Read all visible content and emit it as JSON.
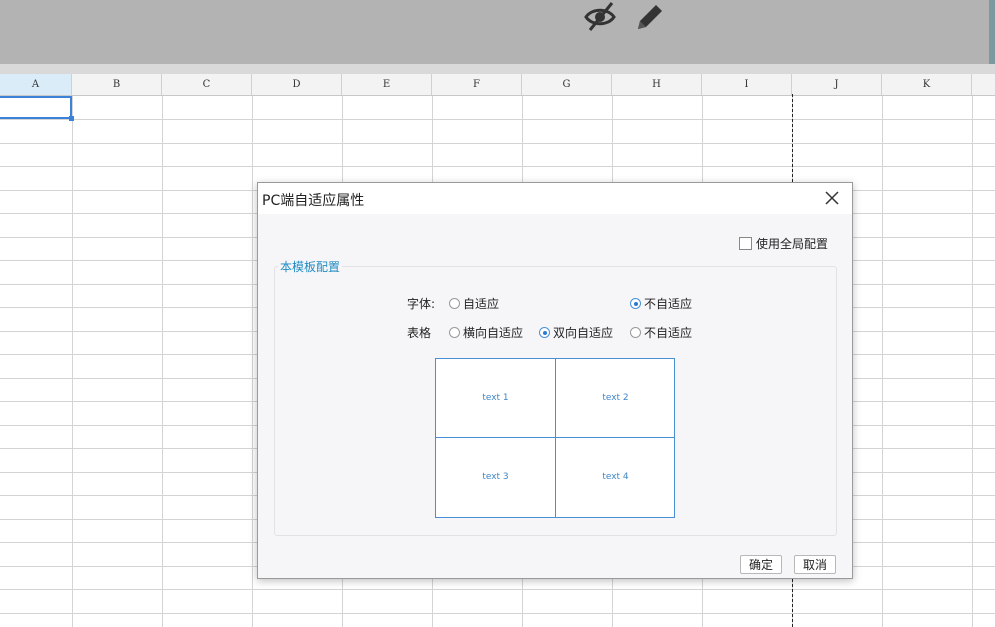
{
  "toolbar": {
    "icons": [
      "eye-off-icon",
      "pencil-icon"
    ]
  },
  "sheet": {
    "columns": [
      "A",
      "B",
      "C",
      "D",
      "E",
      "F",
      "G",
      "H",
      "I",
      "J",
      "K"
    ],
    "selected_cell": "A1"
  },
  "dialog": {
    "title": "PC端自适应属性",
    "global_config_label": "使用全局配置",
    "global_config_checked": false,
    "section_label": "本模板配置",
    "font_row": {
      "label": "字体:",
      "options": [
        "自适应",
        "不自适应"
      ],
      "selected": "不自适应"
    },
    "table_row": {
      "label": "表格",
      "options": [
        "横向自适应",
        "双向自适应",
        "不自适应"
      ],
      "selected": "双向自适应"
    },
    "preview_cells": [
      "text 1",
      "text 2",
      "text 3",
      "text 4"
    ],
    "ok_label": "确定",
    "cancel_label": "取消"
  }
}
